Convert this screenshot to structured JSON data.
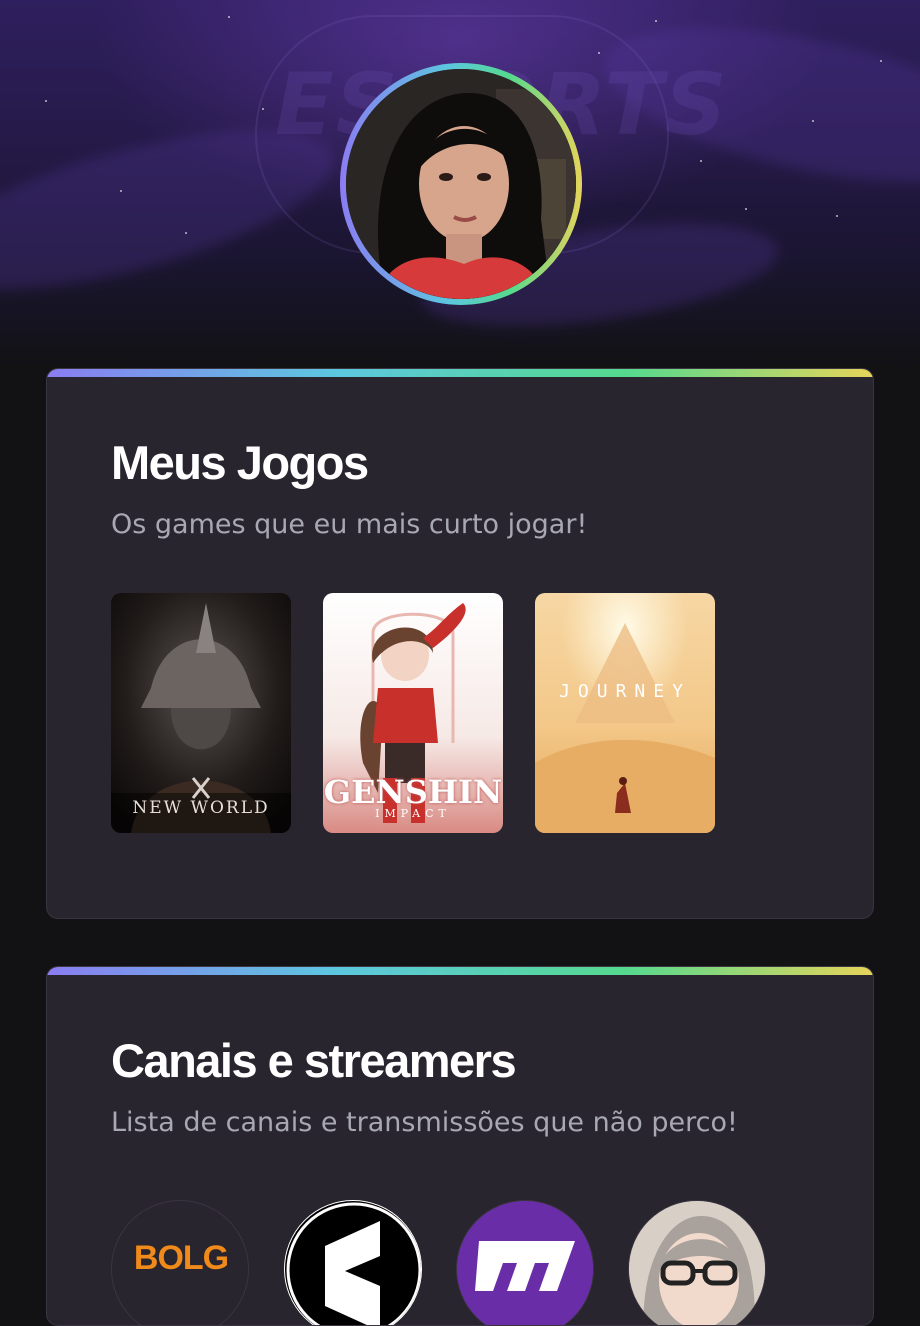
{
  "hero": {
    "background_logo_text": "ESPORTS",
    "avatar_icon": "profile-photo"
  },
  "games_section": {
    "title": "Meus Jogos",
    "subtitle": "Os games que eu mais curto jogar!",
    "games": [
      {
        "name": "NEW WORLD",
        "icon": "new-world-cover"
      },
      {
        "name": "GENSHIN",
        "sub": "IMPACT",
        "icon": "genshin-impact-cover"
      },
      {
        "name": "JOURNEY",
        "icon": "journey-cover"
      }
    ]
  },
  "channels_section": {
    "title": "Canais e streamers",
    "subtitle": "Lista de canais e transmissões que não perco!",
    "channels": [
      {
        "icon": "bolg-logo",
        "label": "BOLG"
      },
      {
        "icon": "rainbow-six-logo"
      },
      {
        "icon": "purple-channel-logo"
      },
      {
        "icon": "streamer-avatar"
      }
    ]
  },
  "colors": {
    "accent_gradient": [
      "#8a7df2",
      "#5cc7df",
      "#55d98e",
      "#e6d45a"
    ],
    "card_bg": "#29252f",
    "page_bg": "#121214",
    "subtitle": "#a8a8b3"
  }
}
